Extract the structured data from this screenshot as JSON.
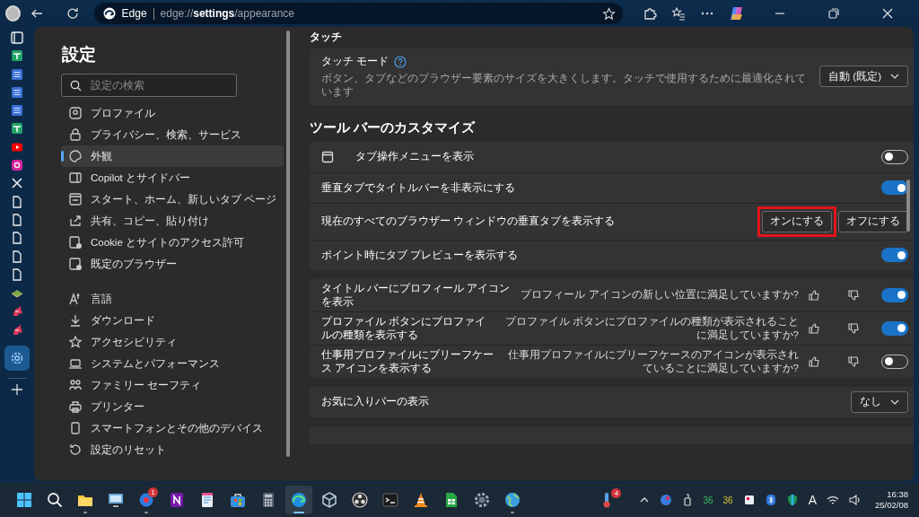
{
  "browser": {
    "site": "Edge",
    "url": "edge://**settings**/appearance"
  },
  "vertical_tabs": [
    {
      "kind": "window",
      "selected": false
    },
    {
      "kind": "sheet",
      "selected": false
    },
    {
      "kind": "doc",
      "selected": false
    },
    {
      "kind": "doc",
      "selected": false
    },
    {
      "kind": "doc",
      "selected": false
    },
    {
      "kind": "sheet",
      "selected": false
    },
    {
      "kind": "video",
      "selected": false
    },
    {
      "kind": "camera",
      "selected": false
    },
    {
      "kind": "x",
      "selected": false
    },
    {
      "kind": "page",
      "selected": false
    },
    {
      "kind": "page",
      "selected": false
    },
    {
      "kind": "page",
      "selected": false
    },
    {
      "kind": "page",
      "selected": false
    },
    {
      "kind": "page",
      "selected": false
    },
    {
      "kind": "book",
      "selected": false
    },
    {
      "kind": "unicorn",
      "selected": false
    },
    {
      "kind": "unicorn",
      "selected": false
    },
    {
      "kind": "settings",
      "selected": true
    }
  ],
  "nav": {
    "title": "設定",
    "search": {
      "placeholder": "設定の検索"
    },
    "groups": [
      [
        {
          "kind": "profile",
          "label": "プロファイル",
          "selected": false
        },
        {
          "kind": "lock",
          "label": "プライバシー、検索、サービス",
          "selected": false
        },
        {
          "kind": "palette",
          "label": "外観",
          "selected": true
        },
        {
          "kind": "sidebar",
          "label": "Copilot とサイドバー",
          "selected": false
        },
        {
          "kind": "home",
          "label": "スタート、ホーム、新しいタブ ページ",
          "selected": false
        },
        {
          "kind": "share",
          "label": "共有、コピー、貼り付け",
          "selected": false
        },
        {
          "kind": "cookie",
          "label": "Cookie とサイトのアクセス許可",
          "selected": false
        },
        {
          "kind": "browser",
          "label": "既定のブラウザー",
          "selected": false
        }
      ],
      [
        {
          "kind": "language",
          "label": "言語",
          "selected": false
        },
        {
          "kind": "download",
          "label": "ダウンロード",
          "selected": false
        },
        {
          "kind": "accessibility",
          "label": "アクセシビリティ",
          "selected": false
        },
        {
          "kind": "laptop",
          "label": "システムとパフォーマンス",
          "selected": false
        },
        {
          "kind": "family",
          "label": "ファミリー セーフティ",
          "selected": false
        },
        {
          "kind": "printer",
          "label": "プリンター",
          "selected": false
        },
        {
          "kind": "phone",
          "label": "スマートフォンとその他のデバイス",
          "selected": false
        },
        {
          "kind": "reset",
          "label": "設定のリセット",
          "selected": false
        }
      ]
    ]
  },
  "content": {
    "touch_heading": "タッチ",
    "touch_card": {
      "title": "タッチ モード",
      "description": "ボタン、タブなどのブラウザー要素のサイズを大きくします。タッチで使用するために最適化されています",
      "dropdown": "自動 (既定)"
    },
    "toolbar_heading": "ツール バーのカスタマイズ",
    "cards": [
      {
        "rows": [
          {
            "kind": "icon_toggle",
            "label": "タブ操作メニューを表示",
            "on": false
          },
          {
            "kind": "toggle",
            "label": "垂直タブでタイトルバーを非表示にする",
            "on": true
          },
          {
            "kind": "buttons",
            "label": "現在のすべてのブラウザー ウィンドウの垂直タブを表示する",
            "buttons": [
              {
                "label": "オンにする",
                "highlighted": true
              },
              {
                "label": "オフにする",
                "highlighted": false
              }
            ]
          },
          {
            "kind": "toggle",
            "label": "ポイント時にタブ プレビューを表示する",
            "on": true
          }
        ]
      },
      {
        "rows": [
          {
            "kind": "toggle",
            "label": "タイトル バーにプロフィール アイコンを表示",
            "feedback": "プロフィール アイコンの新しい位置に満足していますか?",
            "on": true
          },
          {
            "kind": "toggle",
            "label": "プロファイル ボタンにプロファイルの種類を表示する",
            "feedback": "プロファイル ボタンにプロファイルの種類が表示されることに満足していますか?",
            "on": true
          },
          {
            "kind": "toggle",
            "label": "仕事用プロファイルにブリーフケース アイコンを表示する",
            "feedback": "仕事用プロファイルにブリーフケースのアイコンが表示されていることに満足していますか?",
            "on": false
          }
        ]
      },
      {
        "rows": [
          {
            "kind": "dropdown",
            "label": "お気に入りバーの表示",
            "value": "なし"
          }
        ]
      }
    ]
  },
  "taskbar": {
    "apps": [
      {
        "kind": "start",
        "running": false,
        "active": false
      },
      {
        "kind": "search",
        "running": false,
        "active": false
      },
      {
        "kind": "folder",
        "running": true,
        "active": false
      },
      {
        "kind": "monitor",
        "running": false,
        "active": false
      },
      {
        "kind": "messenger",
        "badge": "1",
        "running": true,
        "active": false
      },
      {
        "kind": "notebook",
        "running": false,
        "active": false
      },
      {
        "kind": "notepad",
        "running": false,
        "active": false
      },
      {
        "kind": "store",
        "running": false,
        "active": false
      },
      {
        "kind": "calculator",
        "running": false,
        "active": false
      },
      {
        "kind": "edge",
        "running": true,
        "active": true
      },
      {
        "kind": "cube",
        "running": false,
        "active": false
      },
      {
        "kind": "record",
        "running": false,
        "active": false
      },
      {
        "kind": "terminal",
        "running": false,
        "active": false
      },
      {
        "kind": "cone",
        "running": false,
        "active": false
      },
      {
        "kind": "spreadsheet",
        "running": false,
        "active": false
      },
      {
        "kind": "gear",
        "running": false,
        "active": false
      },
      {
        "kind": "globe",
        "running": true,
        "active": false
      }
    ],
    "weather_badge": "4",
    "readings": [
      {
        "text": "36",
        "color": "#3fbf5f"
      },
      {
        "text": "36",
        "color": "#d9c23a"
      }
    ],
    "ime": "A",
    "time": "16:38",
    "date": "25/02/08"
  }
}
